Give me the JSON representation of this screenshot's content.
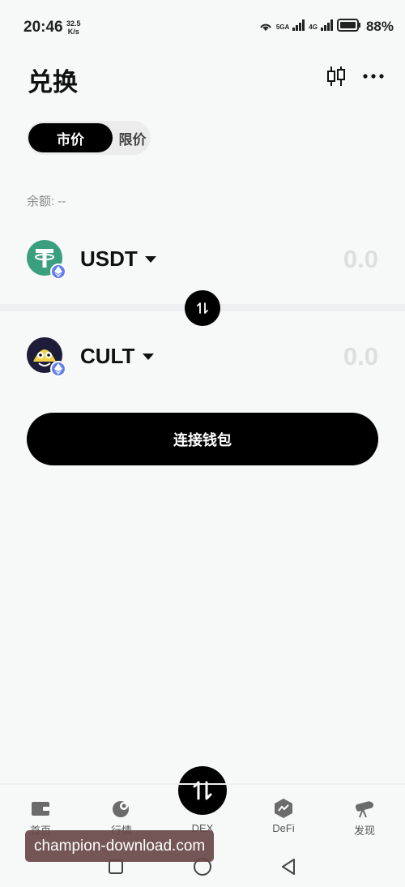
{
  "status_bar": {
    "time": "20:46",
    "speed_value": "32.5",
    "speed_unit": "K/s",
    "sig1_label": "5GA",
    "sig2_label": "4G",
    "battery_percent": "88%"
  },
  "header": {
    "title": "兑换",
    "chart_icon": "candlestick-chart-icon",
    "more_icon": "more-horizontal-icon"
  },
  "tabs": [
    {
      "label": "市价",
      "active": true
    },
    {
      "label": "限价",
      "active": false
    }
  ],
  "balance_label": "余额: --",
  "from_token": {
    "symbol": "USDT",
    "amount": "0.0",
    "logo_color": "#3a9f7e",
    "chain_icon": "ethereum-icon"
  },
  "to_token": {
    "symbol": "CULT",
    "amount": "0.0",
    "chain_icon": "ethereum-icon"
  },
  "swap_icon": "swap-arrows-icon",
  "connect_label": "连接钱包",
  "bottom_nav": [
    {
      "label": "首页",
      "icon": "wallet-icon"
    },
    {
      "label": "行情",
      "icon": "market-icon"
    },
    {
      "label": "DEX",
      "icon": "dex-swap-icon"
    },
    {
      "label": "DeFi",
      "icon": "defi-hexagon-icon"
    },
    {
      "label": "发现",
      "icon": "telescope-icon"
    }
  ],
  "watermark": "champion-download.com",
  "colors": {
    "accent": "#000000",
    "background": "#f7f8f8",
    "placeholder": "#dedede",
    "eth_badge": "#627eea"
  }
}
